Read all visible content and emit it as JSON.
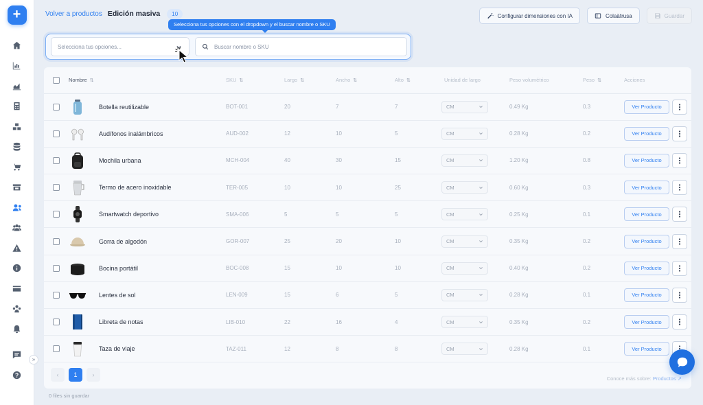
{
  "sidebar": {
    "add_label": "+",
    "collapse_label": "»",
    "icons": [
      "home-icon",
      "chart-icon",
      "analytics-icon",
      "calculator-icon",
      "boxes-icon",
      "database-icon",
      "cart-icon",
      "store-icon",
      "users-icon",
      "team-icon",
      "warning-icon",
      "info-icon",
      "card-icon",
      "group-icon",
      "bell-icon",
      "message-icon",
      "help-icon"
    ],
    "active_icon": "users-icon"
  },
  "header": {
    "back_label": "Volver a productos",
    "mode_title": "Edición masiva",
    "count_badge": "10",
    "configure_ai_label": "Configurar dimensiones con IA",
    "collapse_label": "Colaätrusa",
    "save_label": "Guardar"
  },
  "filter": {
    "tooltip": "Selecciona tus opciones con el dropdown y el buscar nombre o SKU",
    "dropdown_placeholder": "Selecciona tus opciones...",
    "search_placeholder": "Buscar nombre o SKU"
  },
  "table": {
    "columns": {
      "name": "Nombre",
      "sku": "SKU",
      "length": "Largo",
      "width": "Ancho",
      "height": "Alto",
      "unit": "Unidad de largo",
      "volumetric": "Peso volumétrico",
      "weight": "Peso",
      "actions": "Acciones"
    },
    "view_label": "Ver Producto",
    "rows": [
      {
        "name": "Botella reutilizable",
        "sku": "BOT-001",
        "length": "20",
        "width": "7",
        "height": "7",
        "unit": "CM",
        "volumetric": "0.49 Kg",
        "weight": "0.3",
        "icon": "bottle-icon"
      },
      {
        "name": "Audífonos inalámbricos",
        "sku": "AUD-002",
        "length": "12",
        "width": "10",
        "height": "5",
        "unit": "CM",
        "volumetric": "0.28 Kg",
        "weight": "0.2",
        "icon": "earbuds-icon"
      },
      {
        "name": "Mochila urbana",
        "sku": "MCH-004",
        "length": "40",
        "width": "30",
        "height": "15",
        "unit": "CM",
        "volumetric": "1.20 Kg",
        "weight": "0.8",
        "icon": "backpack-icon"
      },
      {
        "name": "Termo de acero inoxidable",
        "sku": "TER-005",
        "length": "10",
        "width": "10",
        "height": "25",
        "unit": "CM",
        "volumetric": "0.60 Kg",
        "weight": "0.3",
        "icon": "tumbler-icon"
      },
      {
        "name": "Smartwatch deportivo",
        "sku": "SMA-006",
        "length": "5",
        "width": "5",
        "height": "5",
        "unit": "CM",
        "volumetric": "0.25 Kg",
        "weight": "0.1",
        "icon": "smartwatch-icon"
      },
      {
        "name": "Gorra de algodón",
        "sku": "GOR-007",
        "length": "25",
        "width": "20",
        "height": "10",
        "unit": "CM",
        "volumetric": "0.35 Kg",
        "weight": "0.2",
        "icon": "cap-icon"
      },
      {
        "name": "Bocina portátil",
        "sku": "BOC-008",
        "length": "15",
        "width": "10",
        "height": "10",
        "unit": "CM",
        "volumetric": "0.40 Kg",
        "weight": "0.2",
        "icon": "speaker-icon"
      },
      {
        "name": "Lentes de sol",
        "sku": "LEN-009",
        "length": "15",
        "width": "6",
        "height": "5",
        "unit": "CM",
        "volumetric": "0.28 Kg",
        "weight": "0.1",
        "icon": "sunglasses-icon"
      },
      {
        "name": "Libreta de notas",
        "sku": "LIB-010",
        "length": "22",
        "width": "16",
        "height": "4",
        "unit": "CM",
        "volumetric": "0.35 Kg",
        "weight": "0.2",
        "icon": "notebook-icon"
      },
      {
        "name": "Taza de viaje",
        "sku": "TAZ-011",
        "length": "12",
        "width": "8",
        "height": "8",
        "unit": "CM",
        "volumetric": "0.28 Kg",
        "weight": "0.1",
        "icon": "travel-mug-icon"
      }
    ]
  },
  "pagination": {
    "prev": "‹",
    "current": "1",
    "next": "›"
  },
  "footer": {
    "learn_more_prefix": "Conoce más sobre:",
    "learn_more_link": "Productos",
    "unsaved_status": "0 files sin guardar"
  },
  "colors": {
    "accent": "#2f7ff0",
    "fab": "#1f6fe0"
  }
}
